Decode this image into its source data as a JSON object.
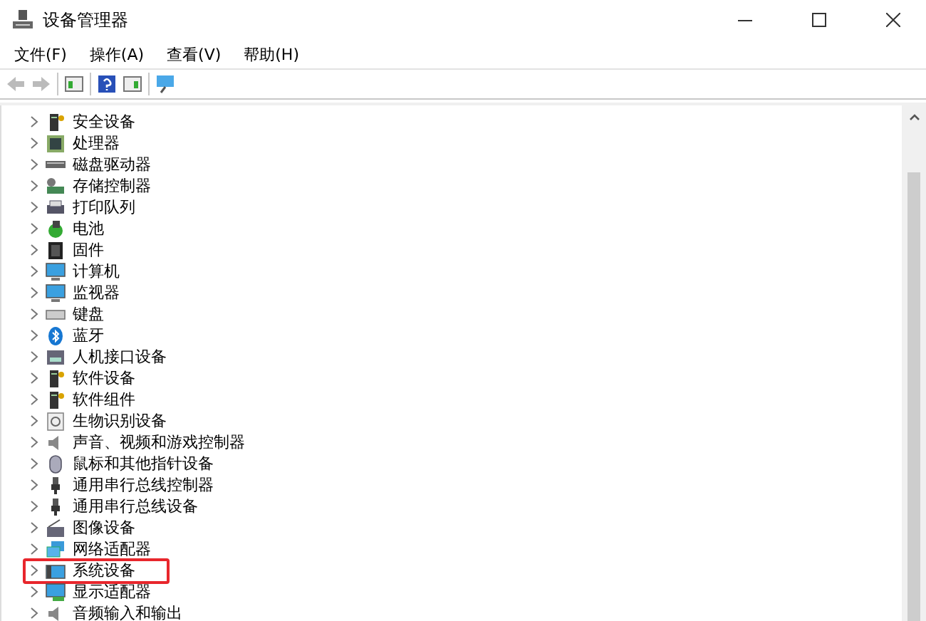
{
  "window": {
    "title": "设备管理器"
  },
  "menu": [
    {
      "label": "文件(F)"
    },
    {
      "label": "操作(A)"
    },
    {
      "label": "查看(V)"
    },
    {
      "label": "帮助(H)"
    }
  ],
  "toolbar": [
    {
      "kind": "back",
      "disabled": true
    },
    {
      "kind": "forward",
      "disabled": true
    },
    {
      "kind": "sep"
    },
    {
      "kind": "pane"
    },
    {
      "kind": "sep"
    },
    {
      "kind": "help"
    },
    {
      "kind": "pane2"
    },
    {
      "kind": "sep"
    },
    {
      "kind": "monitor"
    }
  ],
  "tree": [
    {
      "label": "安全设备",
      "kind": "tower",
      "highlighted": false
    },
    {
      "label": "处理器",
      "kind": "chip",
      "highlighted": false
    },
    {
      "label": "磁盘驱动器",
      "kind": "drive",
      "highlighted": false
    },
    {
      "label": "存储控制器",
      "kind": "storage",
      "highlighted": false
    },
    {
      "label": "打印队列",
      "kind": "printer",
      "highlighted": false
    },
    {
      "label": "电池",
      "kind": "battery",
      "highlighted": false
    },
    {
      "label": "固件",
      "kind": "firmware",
      "highlighted": false
    },
    {
      "label": "计算机",
      "kind": "monitor",
      "highlighted": false
    },
    {
      "label": "监视器",
      "kind": "monitor",
      "highlighted": false
    },
    {
      "label": "键盘",
      "kind": "keyboard",
      "highlighted": false
    },
    {
      "label": "蓝牙",
      "kind": "bluetooth",
      "highlighted": false
    },
    {
      "label": "人机接口设备",
      "kind": "hid",
      "highlighted": false
    },
    {
      "label": "软件设备",
      "kind": "tower",
      "highlighted": false
    },
    {
      "label": "软件组件",
      "kind": "tower",
      "highlighted": false
    },
    {
      "label": "生物识别设备",
      "kind": "fingerprint",
      "highlighted": false
    },
    {
      "label": "声音、视频和游戏控制器",
      "kind": "speaker",
      "highlighted": false
    },
    {
      "label": "鼠标和其他指针设备",
      "kind": "mouse",
      "highlighted": false
    },
    {
      "label": "通用串行总线控制器",
      "kind": "usb",
      "highlighted": false
    },
    {
      "label": "通用串行总线设备",
      "kind": "usb",
      "highlighted": false
    },
    {
      "label": "图像设备",
      "kind": "camera",
      "highlighted": false
    },
    {
      "label": "网络适配器",
      "kind": "network",
      "highlighted": false
    },
    {
      "label": "系统设备",
      "kind": "system",
      "highlighted": true
    },
    {
      "label": "显示适配器",
      "kind": "display",
      "highlighted": false
    },
    {
      "label": "音频输入和输出",
      "kind": "speaker",
      "highlighted": false
    }
  ]
}
